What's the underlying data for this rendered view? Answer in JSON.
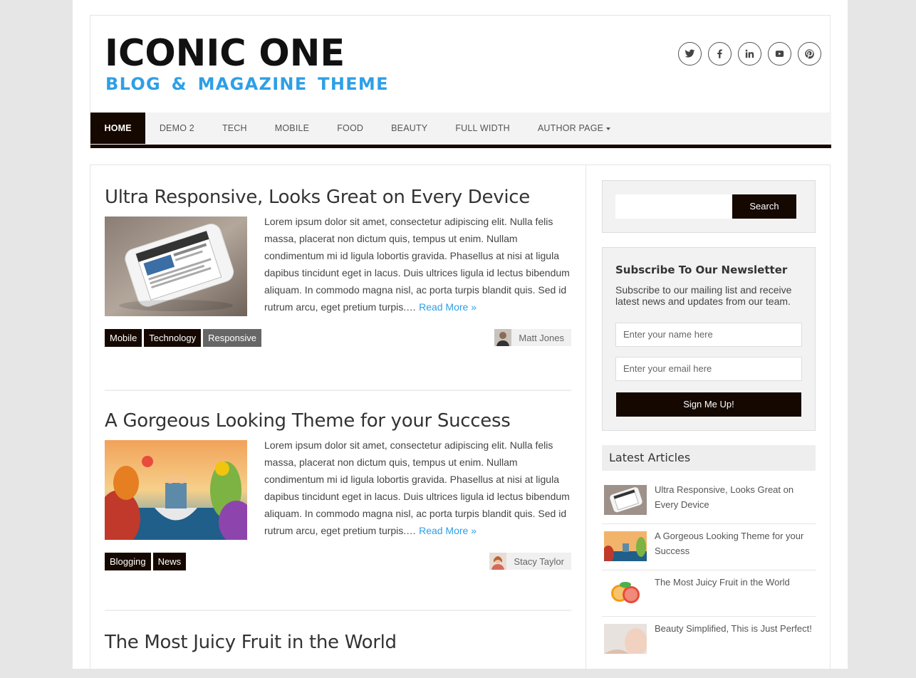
{
  "header": {
    "logo_title": "ICONIC ONE",
    "logo_subtitle": "BLOG & MAGAZINE THEME",
    "social_icons": [
      "twitter-icon",
      "facebook-icon",
      "linkedin-icon",
      "youtube-icon",
      "pinterest-icon"
    ]
  },
  "nav": {
    "items": [
      {
        "label": "HOME"
      },
      {
        "label": "DEMO 2"
      },
      {
        "label": "TECH"
      },
      {
        "label": "MOBILE"
      },
      {
        "label": "FOOD"
      },
      {
        "label": "BEAUTY"
      },
      {
        "label": "FULL WIDTH"
      },
      {
        "label": "AUTHOR PAGE"
      }
    ]
  },
  "posts": [
    {
      "title": "Ultra Responsive, Looks Great on Every Device",
      "excerpt": "Lorem ipsum dolor sit amet, consectetur adipiscing elit. Nulla felis massa, placerat non dictum quis, tempus ut enim. Nullam condimentum mi id ligula lobortis gravida. Phasellus at nisi at ligula dapibus tincidunt eget in lacus. Duis ultrices ligula id lectus bibendum aliquam. In commodo magna nisl, ac porta turpis blandit quis. Sed id rutrum arcu, eget pretium turpis.…",
      "read_more": "Read More »",
      "tags": [
        "Mobile",
        "Technology",
        "Responsive"
      ],
      "author": "Matt Jones"
    },
    {
      "title": "A Gorgeous Looking Theme for your Success",
      "excerpt": "Lorem ipsum dolor sit amet, consectetur adipiscing elit. Nulla felis massa, placerat non dictum quis, tempus ut enim. Nullam condimentum mi id ligula lobortis gravida. Phasellus at nisi at ligula dapibus tincidunt eget in lacus. Duis ultrices ligula id lectus bibendum aliquam. In commodo magna nisl, ac porta turpis blandit quis. Sed id rutrum arcu, eget pretium turpis.…",
      "read_more": "Read More »",
      "tags": [
        "Blogging",
        "News"
      ],
      "author": "Stacy Taylor"
    },
    {
      "title": "The Most Juicy Fruit in the World"
    }
  ],
  "sidebar": {
    "search_button": "Search",
    "newsletter": {
      "title": "Subscribe To Our Newsletter",
      "text": "Subscribe to our mailing list and receive latest news and updates from our team.",
      "name_placeholder": "Enter your name here",
      "email_placeholder": "Enter your email here",
      "button": "Sign Me Up!"
    },
    "latest": {
      "heading": "Latest Articles",
      "items": [
        {
          "title": "Ultra Responsive, Looks Great on Every Device"
        },
        {
          "title": "A Gorgeous Looking Theme for your Success"
        },
        {
          "title": "The Most Juicy Fruit in the World"
        },
        {
          "title": "Beauty Simplified, This is Just Perfect!"
        }
      ]
    }
  },
  "colors": {
    "accent": "#2e9fe6",
    "dark": "#150800"
  }
}
